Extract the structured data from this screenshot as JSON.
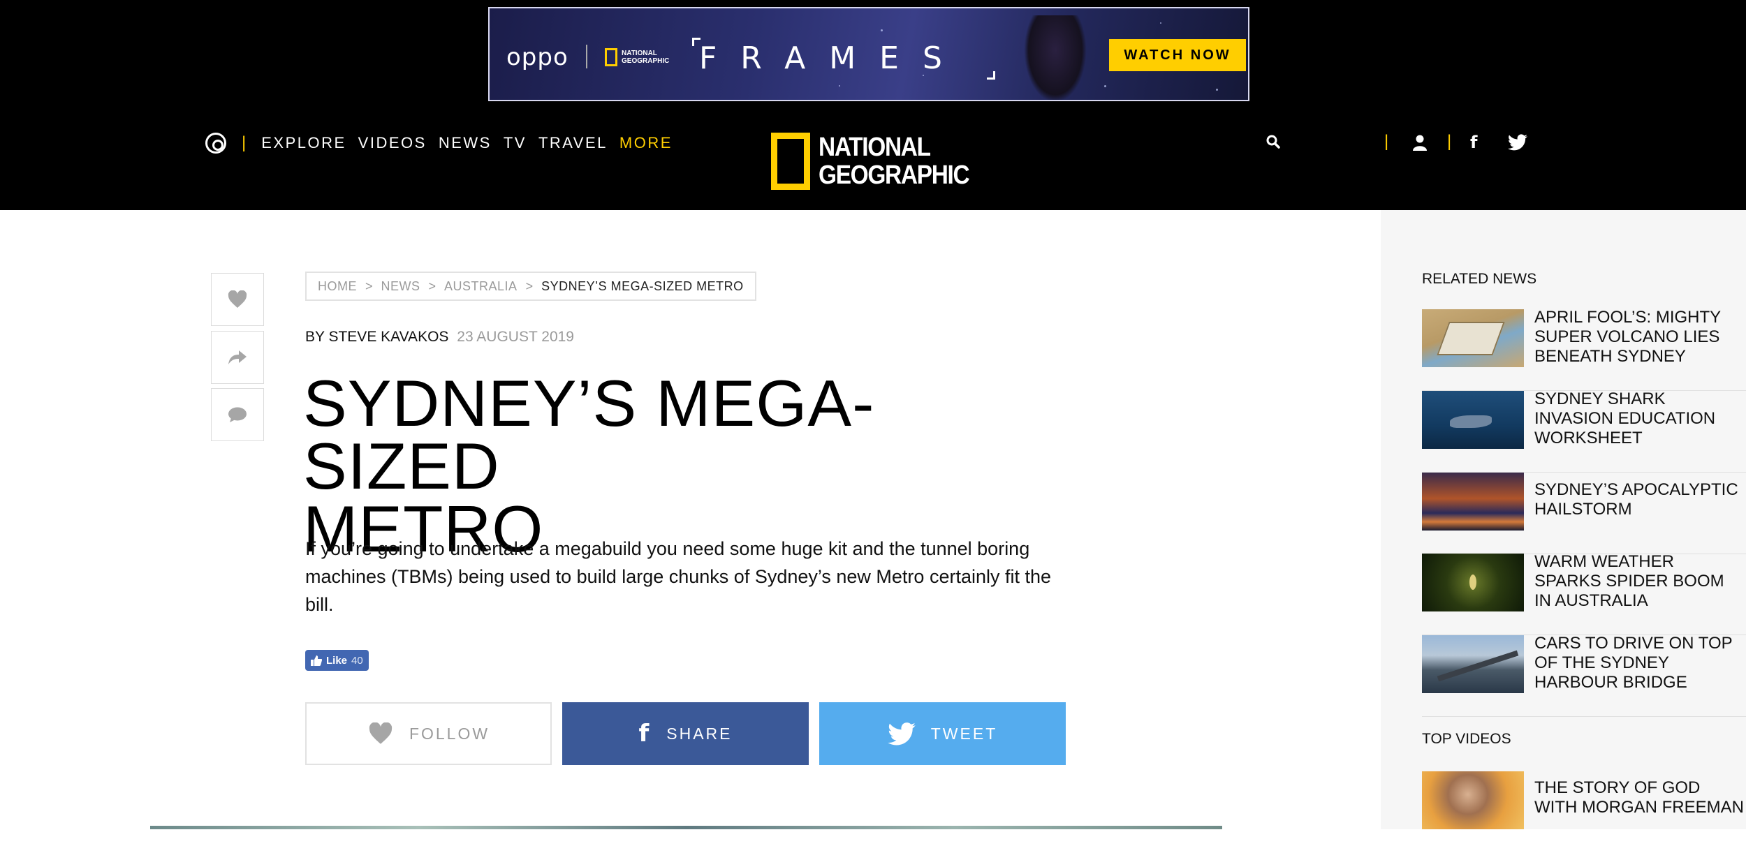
{
  "ad": {
    "brand": "oppo",
    "partner": "NATIONAL GEOGRAPHIC",
    "campaign": "FRAMES",
    "cta": "WATCH NOW"
  },
  "nav": {
    "items": [
      "EXPLORE",
      "VIDEOS",
      "NEWS",
      "TV",
      "TRAVEL"
    ],
    "more": "MORE"
  },
  "logo": {
    "line1": "NATIONAL",
    "line2": "GEOGRAPHIC"
  },
  "colors": {
    "brand_yellow": "#ffce00",
    "facebook": "#3b5998",
    "twitter": "#55acee",
    "fb_like": "#4267b2"
  },
  "breadcrumb": {
    "home": "HOME",
    "news": "NEWS",
    "section": "AUSTRALIA",
    "current": "SYDNEY’S MEGA-SIZED METRO",
    "separator": ">"
  },
  "article": {
    "author": "BY STEVE KAVAKOS",
    "date": "23 AUGUST 2019",
    "title_line1": "SYDNEY’S MEGA-SIZED",
    "title_line2": "METRO",
    "standfirst": "If you’re going to undertake a megabuild you need some huge kit and the tunnel boring machines (TBMs) being used to build large chunks of Sydney’s new Metro certainly fit the bill."
  },
  "like": {
    "label": "Like",
    "count": "40"
  },
  "actions": {
    "follow": "FOLLOW",
    "share": "SHARE",
    "tweet": "TWEET"
  },
  "side_buttons": [
    "heart-icon",
    "share-arrow-icon",
    "comment-icon"
  ],
  "sidebar": {
    "related_heading": "RELATED NEWS",
    "related": [
      {
        "title": "APRIL FOOL’S: MIGHTY SUPER VOLCANO LIES BENEATH SYDNEY"
      },
      {
        "title": "SYDNEY SHARK INVASION EDUCATION WORKSHEET"
      },
      {
        "title": "SYDNEY’S APOCALYPTIC HAILSTORM"
      },
      {
        "title": "WARM WEATHER SPARKS SPIDER BOOM IN AUSTRALIA"
      },
      {
        "title": "CARS TO DRIVE ON TOP OF THE SYDNEY HARBOUR BRIDGE"
      }
    ],
    "videos_heading": "TOP VIDEOS",
    "videos": [
      {
        "title": "THE STORY OF GOD WITH MORGAN FREEMAN"
      }
    ]
  }
}
